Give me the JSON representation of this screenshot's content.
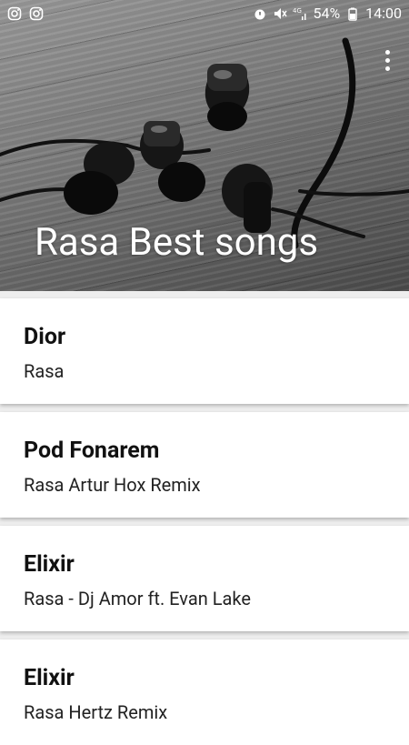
{
  "status_bar": {
    "left_icons": [
      "instagram-icon",
      "instagram-icon"
    ],
    "right_icons": [
      "alarm-icon",
      "vibrate-mute-icon",
      "4g-signal-icon",
      "battery-icon"
    ],
    "battery": "54%",
    "time": "14:00"
  },
  "header": {
    "title": "Rasa Best songs",
    "menu_icon": "more-vert-icon",
    "colors": {
      "title": "#ffffff"
    }
  },
  "songs": [
    {
      "title": "Dior",
      "artist": "Rasa"
    },
    {
      "title": "Pod Fonarem",
      "artist": "Rasa Artur Hox Remix"
    },
    {
      "title": "Elixir",
      "artist": "Rasa - Dj Amor ft. Evan Lake"
    },
    {
      "title": "Elixir",
      "artist": "Rasa Hertz Remix"
    }
  ],
  "colors": {
    "background": "#eeeeee",
    "card": "#ffffff",
    "text_primary": "#111111"
  }
}
